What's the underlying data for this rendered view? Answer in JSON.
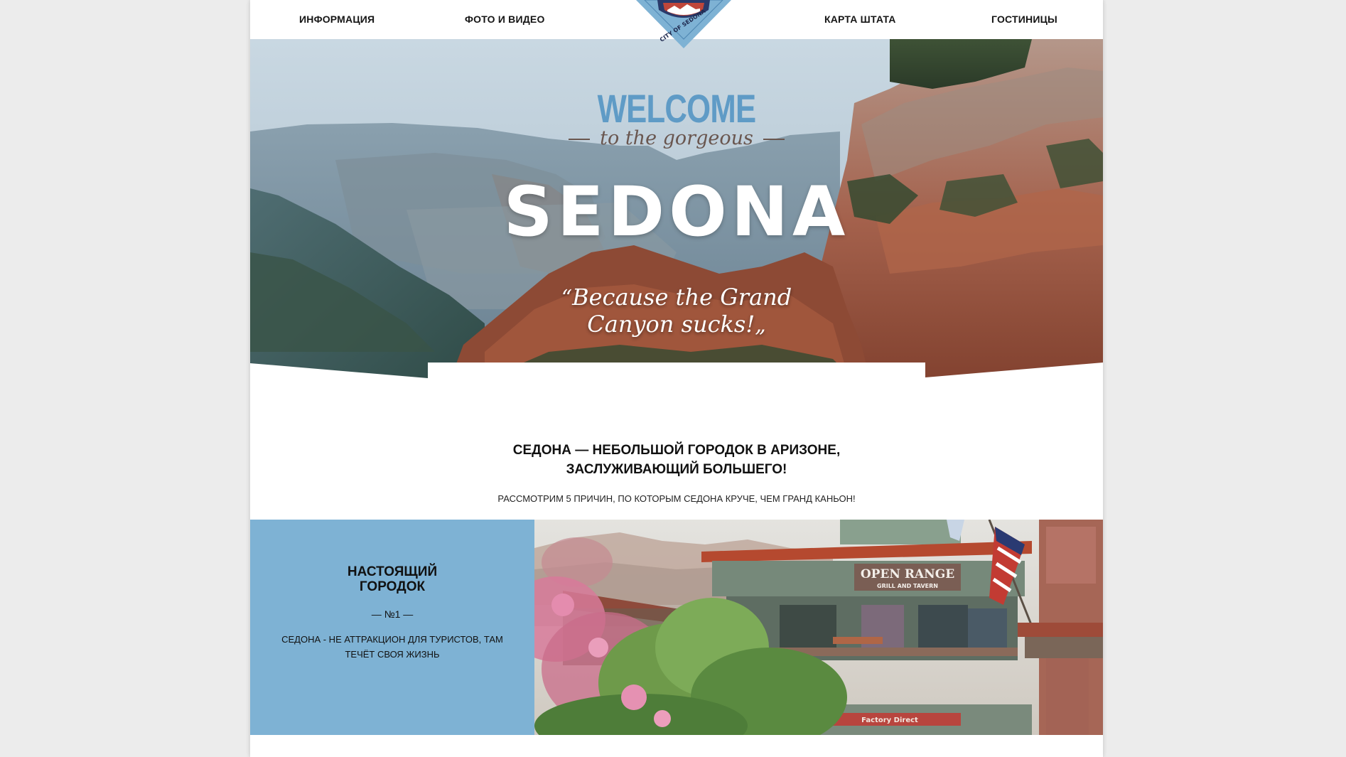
{
  "nav": {
    "info": "ИНФОРМАЦИЯ",
    "media": "ФОТО И ВИДЕО",
    "map": "КАРТА ШТАТА",
    "hotels": "ГОСТИНИЦЫ",
    "logo_text": "CITY OF SEDONA"
  },
  "hero": {
    "welcome": "WELCOME",
    "gorgeous": "to the gorgeous",
    "city": "SEDONA",
    "quote_line1": "Because the Grand",
    "quote_line2": "Canyon sucks!"
  },
  "intro": {
    "title_line1": "СЕДОНА — НЕБОЛЬШОЙ ГОРОДОК В АРИЗОНЕ,",
    "title_line2": "ЗАСЛУЖИВАЮЩИЙ БОЛЬШЕГО!",
    "subtitle": "РАССМОТРИМ 5 ПРИЧИН, ПО КОТОРЫМ СЕДОНА КРУЧЕ, ЧЕМ ГРАНД КАНЬОН!"
  },
  "feature": {
    "title_line1": "НАСТОЯЩИЙ",
    "title_line2": "ГОРОДОК",
    "number": "— №1 —",
    "text": "СЕДОНА - НЕ АТТРАКЦИОН ДЛЯ ТУРИСТОВ, ТАМ ТЕЧЁТ СВОЯ ЖИЗНЬ",
    "photo_sign": "OPEN RANGE",
    "photo_sign_sub": "GRILL AND TAVERN",
    "photo_store": "Factory Direct"
  },
  "colors": {
    "accent_blue": "#7eb2d4",
    "welcome_blue": "#5f9bc6",
    "script_brown": "#69564f"
  }
}
